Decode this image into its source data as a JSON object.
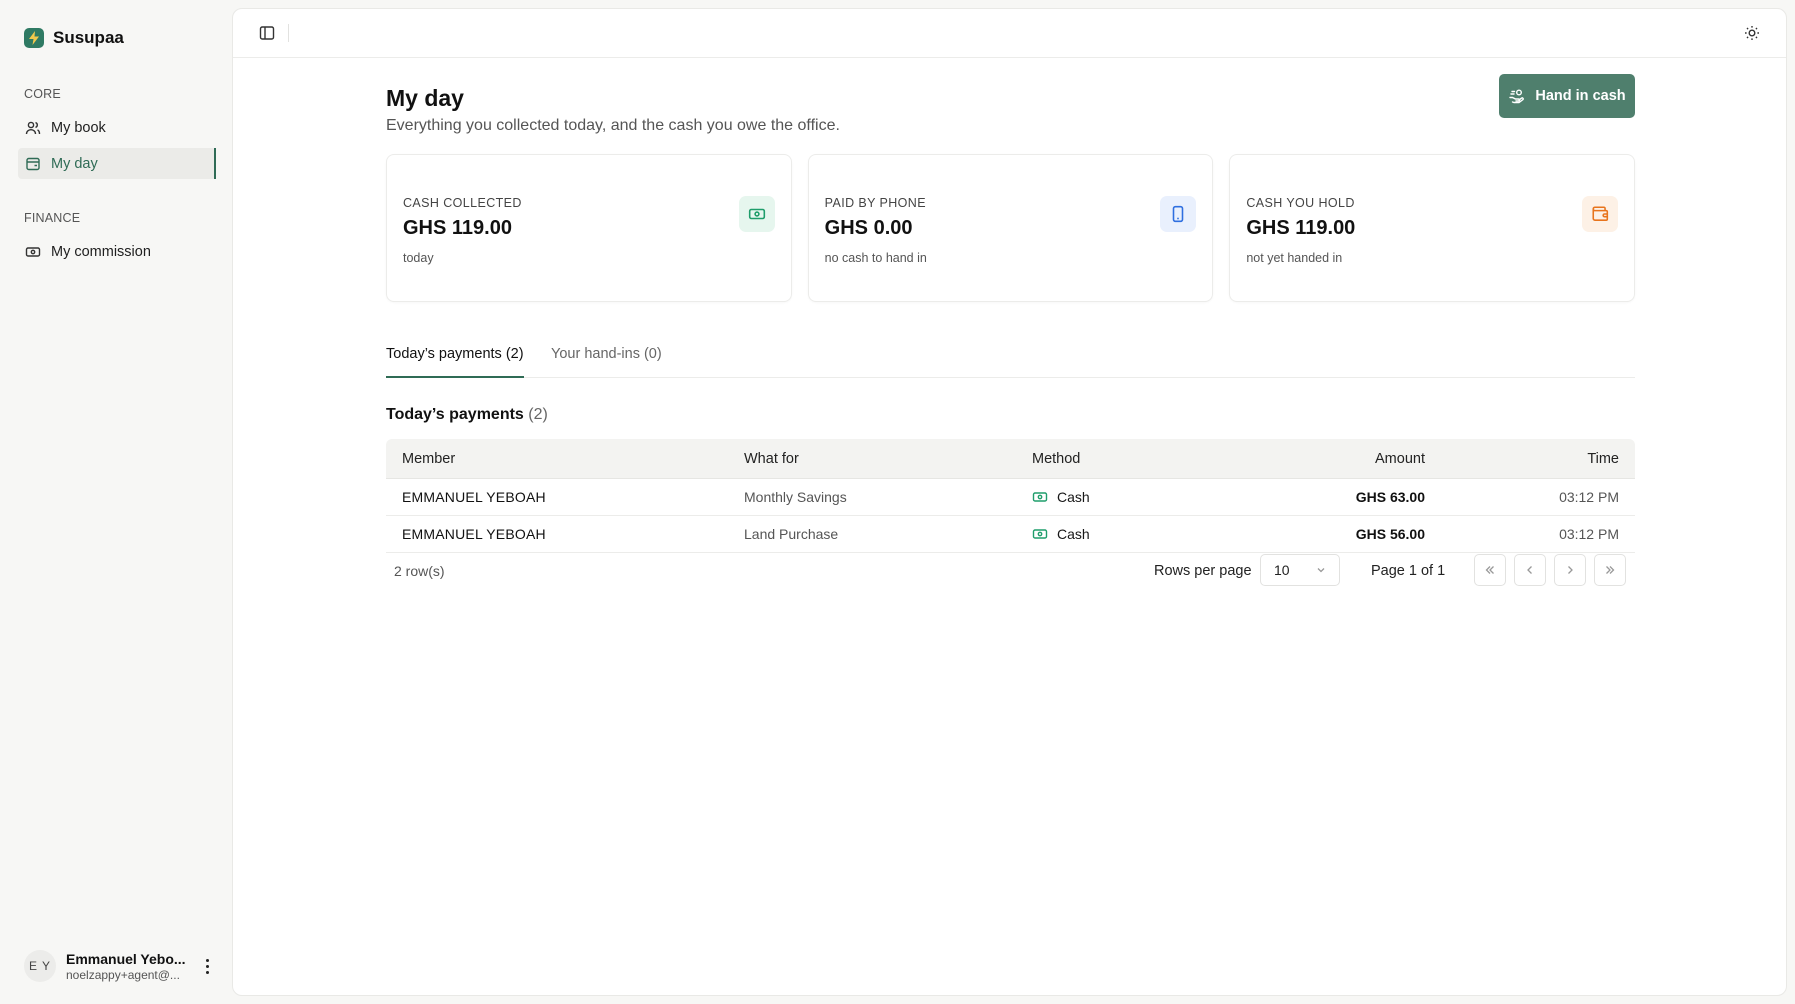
{
  "brand": {
    "name": "Susupaa",
    "logo_icon": "bolt-icon",
    "logo_color": "#2f7a63"
  },
  "sidebar": {
    "groups": [
      {
        "label": "CORE",
        "items": [
          {
            "label": "My book",
            "icon": "users-icon",
            "active": false
          },
          {
            "label": "My day",
            "icon": "calendar-wallet-icon",
            "active": true
          }
        ]
      },
      {
        "label": "FINANCE",
        "items": [
          {
            "label": "My commission",
            "icon": "banknote-icon",
            "active": false
          }
        ]
      }
    ],
    "user": {
      "initials": "E Y",
      "name": "Emmanuel Yebo...",
      "email": "noelzappy+agent@..."
    }
  },
  "topbar": {
    "toggle_icon": "sidebar-toggle-icon",
    "theme_icon": "sun-icon"
  },
  "page": {
    "title": "My day",
    "subtitle": "Everything you collected today, and the cash you owe the office.",
    "primary_action": "Hand in cash"
  },
  "cards": [
    {
      "label": "CASH COLLECTED",
      "value": "GHS 119.00",
      "note": "today",
      "icon": "banknote-icon",
      "accent": "#1f9d6b",
      "icon_bg": "#e6f6ee"
    },
    {
      "label": "PAID BY PHONE",
      "value": "GHS 0.00",
      "note": "no cash to hand in",
      "icon": "phone-icon",
      "accent": "#2f6fe0",
      "icon_bg": "#e9f0fd"
    },
    {
      "label": "CASH YOU HOLD",
      "value": "GHS 119.00",
      "note": "not yet handed in",
      "icon": "wallet-icon",
      "accent": "#e8741c",
      "icon_bg": "#fdf1e6"
    }
  ],
  "tabs": [
    {
      "label": "Today’s payments (2)",
      "active": true
    },
    {
      "label": "Your hand-ins (0)",
      "active": false
    }
  ],
  "section": {
    "title": "Today’s payments",
    "count": "(2)"
  },
  "table": {
    "columns": [
      "Member",
      "What for",
      "Method",
      "Amount",
      "Time"
    ],
    "rows": [
      {
        "member": "EMMANUEL YEBOAH",
        "what_for": "Monthly Savings",
        "method": "Cash",
        "amount": "GHS 63.00",
        "time": "03:12 PM"
      },
      {
        "member": "EMMANUEL YEBOAH",
        "what_for": "Land Purchase",
        "method": "Cash",
        "amount": "GHS 56.00",
        "time": "03:12 PM"
      }
    ]
  },
  "pagination": {
    "row_count": "2 row(s)",
    "rows_per_page_label": "Rows per page",
    "rows_per_page": "10",
    "page_label": "Page 1 of 1"
  }
}
